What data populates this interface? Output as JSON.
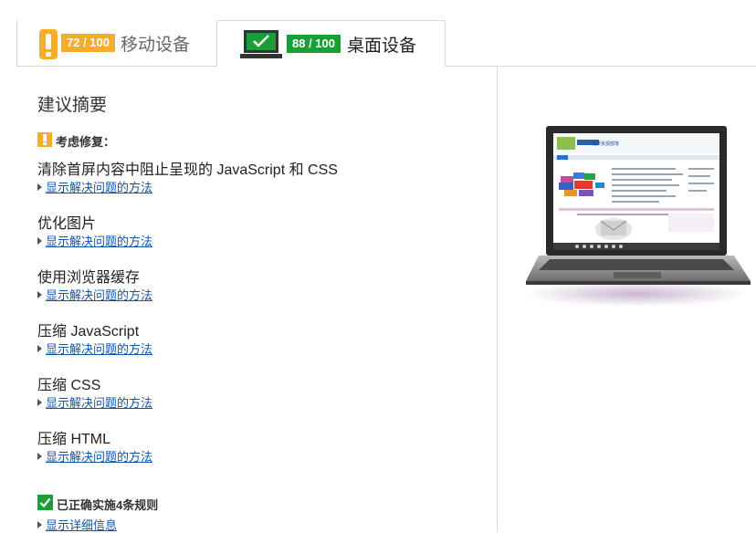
{
  "colors": {
    "warning": "#f5ad2b",
    "good": "#1a9e36",
    "link": "#1155aa",
    "border": "#d9d9d9"
  },
  "tabs": [
    {
      "name": "mobile",
      "label": "移动设备",
      "score": "72 / 100",
      "icon": "phone-warning-icon",
      "active": false
    },
    {
      "name": "desktop",
      "label": "桌面设备",
      "score": "88 / 100",
      "icon": "laptop-check-icon",
      "active": true
    }
  ],
  "summary": {
    "title": "建议摘要",
    "consider_label": "考虑修复：",
    "consider_icon": "warning-icon",
    "rules": [
      {
        "title": "清除首屏内容中阻止呈现的 JavaScript 和 CSS",
        "link": "显示解决问题的方法"
      },
      {
        "title": "优化图片",
        "link": "显示解决问题的方法"
      },
      {
        "title": "使用浏览器缓存",
        "link": "显示解决问题的方法"
      },
      {
        "title": "压缩 JavaScript",
        "link": "显示解决问题的方法"
      },
      {
        "title": "压缩 CSS",
        "link": "显示解决问题的方法"
      },
      {
        "title": "压缩 HTML",
        "link": "显示解决问题的方法"
      }
    ],
    "passed_label": "已正确实施4条规则",
    "passed_icon": "checkmark-icon",
    "passed_link": "显示详细信息"
  },
  "preview": {
    "icon": "laptop-screenshot-preview",
    "site_name": "免费资源部落"
  }
}
